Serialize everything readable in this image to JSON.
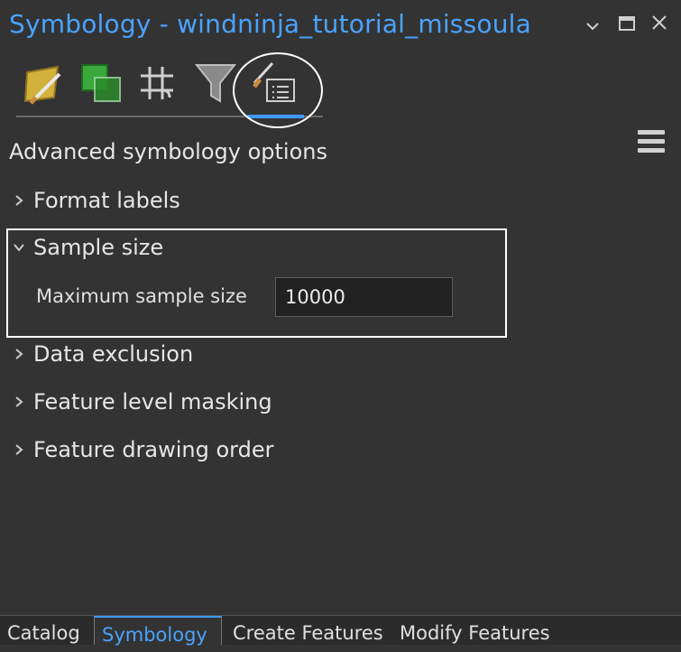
{
  "window": {
    "title": "Symbology - windninja_tutorial_missoula",
    "controls": [
      "chevron-down-icon",
      "maximize-icon",
      "close-icon"
    ]
  },
  "toolbar": {
    "tools": [
      {
        "name": "primary-symbology-icon"
      },
      {
        "name": "vary-symbology-icon"
      },
      {
        "name": "symbol-layer-drawing-icon"
      },
      {
        "name": "filter-icon"
      },
      {
        "name": "advanced-symbology-icon",
        "active": true
      }
    ],
    "menu": "menu-icon"
  },
  "panel": {
    "section_title": "Advanced symbology options",
    "groups": [
      {
        "label": "Format labels",
        "expanded": false
      },
      {
        "label": "Sample size",
        "expanded": true
      },
      {
        "label": "Data exclusion",
        "expanded": false
      },
      {
        "label": "Feature level masking",
        "expanded": false
      },
      {
        "label": "Feature drawing order",
        "expanded": false
      }
    ],
    "sample_size": {
      "label": "Maximum sample size",
      "value": "10000"
    }
  },
  "bottom_tabs": [
    {
      "label": "Catalog",
      "active": false
    },
    {
      "label": "Symbology",
      "active": true
    },
    {
      "label": "Create Features",
      "active": false
    },
    {
      "label": "Modify Features",
      "active": false
    }
  ],
  "colors": {
    "background": "#333333",
    "accent": "#3d9bff",
    "title": "#4aa3ff",
    "text": "#e6e6e6"
  }
}
